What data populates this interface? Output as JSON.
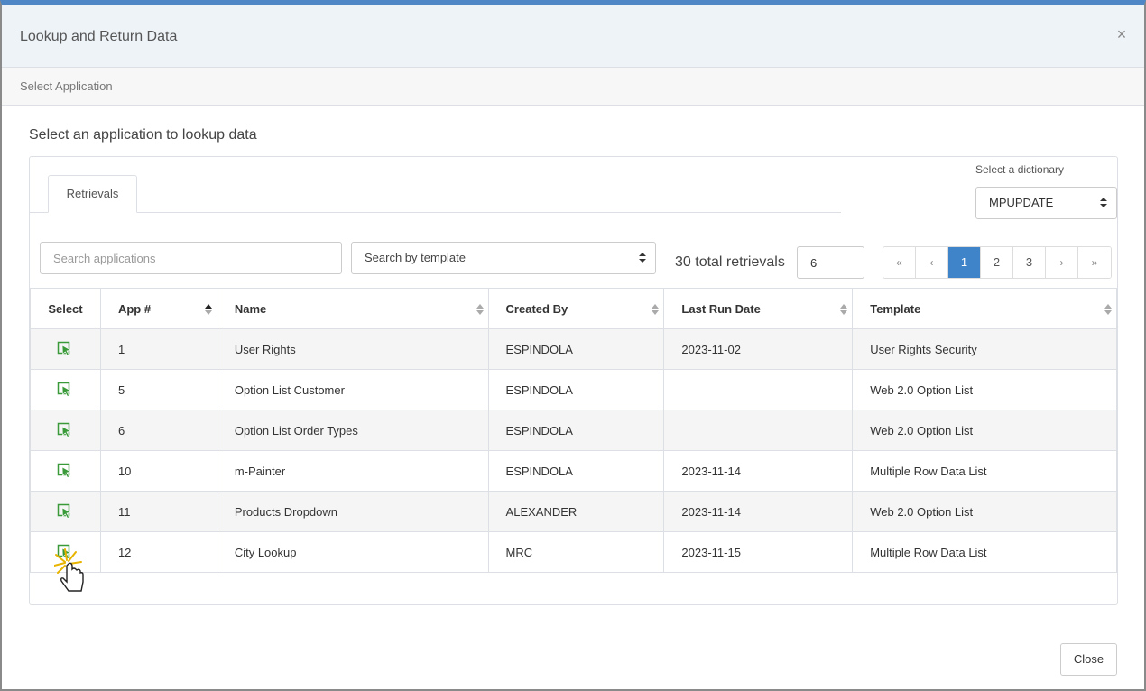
{
  "dialog": {
    "title": "Lookup and Return Data",
    "close_glyph": "×",
    "breadcrumb": "Select Application",
    "prompt": "Select an application to lookup data",
    "close_button": "Close"
  },
  "tabs": [
    {
      "label": "Retrievals",
      "active": true
    }
  ],
  "dictionary": {
    "label": "Select a dictionary",
    "selected": "MPUPDATE"
  },
  "filters": {
    "search_placeholder": "Search applications",
    "template_placeholder": "Search by template"
  },
  "summary": {
    "total_text": "30 total retrievals",
    "page_size": "6"
  },
  "pagination": {
    "first": "«",
    "prev": "‹",
    "pages": [
      "1",
      "2",
      "3"
    ],
    "active_page": "1",
    "next": "›",
    "last": "»"
  },
  "table": {
    "columns": [
      "Select",
      "App #",
      "Name",
      "Created By",
      "Last Run Date",
      "Template"
    ],
    "sorted_column": "App #",
    "sort_direction": "ascending",
    "rows": [
      {
        "app": "1",
        "name": "User Rights",
        "created_by": "ESPINDOLA",
        "last_run": "2023-11-02",
        "template": "User Rights Security"
      },
      {
        "app": "5",
        "name": "Option List Customer",
        "created_by": "ESPINDOLA",
        "last_run": "",
        "template": "Web 2.0 Option List"
      },
      {
        "app": "6",
        "name": "Option List Order Types",
        "created_by": "ESPINDOLA",
        "last_run": "",
        "template": "Web 2.0 Option List"
      },
      {
        "app": "10",
        "name": "m-Painter",
        "created_by": "ESPINDOLA",
        "last_run": "2023-11-14",
        "template": "Multiple Row Data List"
      },
      {
        "app": "11",
        "name": "Products Dropdown",
        "created_by": "ALEXANDER",
        "last_run": "2023-11-14",
        "template": "Web 2.0 Option List"
      },
      {
        "app": "12",
        "name": "City Lookup",
        "created_by": "MRC",
        "last_run": "2023-11-15",
        "template": "Multiple Row Data List"
      }
    ]
  },
  "colors": {
    "accent": "#3f83c9",
    "select_icon": "#3a9a3a",
    "header_bg": "#eef3f8"
  },
  "icons": {
    "row_select": "select-pointer-icon",
    "cursor": "hand-pointer-cursor"
  }
}
